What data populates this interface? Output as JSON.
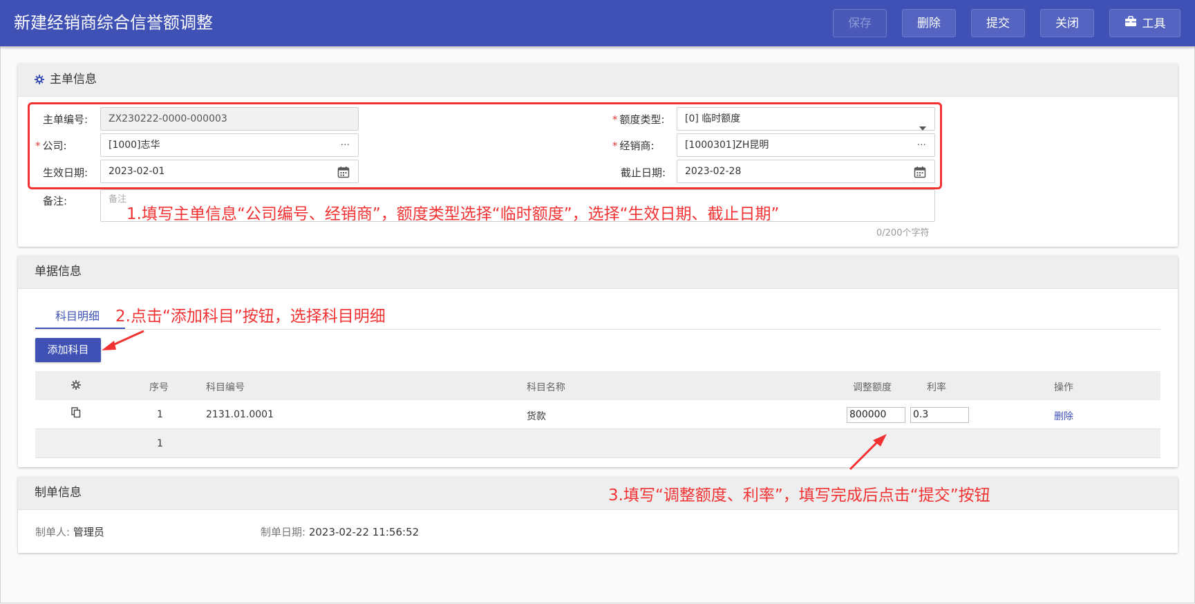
{
  "header": {
    "title": "新建经销商综合信誉额调整",
    "buttons": {
      "save": "保存",
      "delete": "删除",
      "submit": "提交",
      "close": "关闭",
      "tools": "工具"
    }
  },
  "main_info": {
    "title": "主单信息",
    "order_no": {
      "label": "主单编号:",
      "value": "ZX230222-0000-000003"
    },
    "company": {
      "required": "*",
      "label": "公司:",
      "value": "[1000]志华",
      "suffix": "···"
    },
    "effective_date": {
      "label": "生效日期:",
      "value": "2023-02-01"
    },
    "quota_type": {
      "required": "*",
      "label": "额度类型:",
      "value": "[0] 临时额度"
    },
    "dealer": {
      "required": "*",
      "label": "经销商:",
      "value": "[1000301]ZH昆明",
      "suffix": "···"
    },
    "end_date": {
      "label": "截止日期:",
      "value": "2023-02-28"
    },
    "remark": {
      "label": "备注:",
      "placeholder": "备注",
      "counter": "0/200个字符"
    }
  },
  "doc_info": {
    "title": "单据信息",
    "tab": "科目明细",
    "add_button": "添加科目",
    "columns": {
      "seq": "序号",
      "code": "科目编号",
      "name": "科目名称",
      "amount": "调整额度",
      "rate": "利率",
      "action": "操作"
    },
    "rows": [
      {
        "seq": "1",
        "code": "2131.01.0001",
        "name": "货款",
        "amount": "800000",
        "rate": "0.3",
        "action": "删除"
      }
    ],
    "summary": {
      "seq": "1"
    }
  },
  "maker_info": {
    "title": "制单信息",
    "maker_label": "制单人:",
    "maker": "管理员",
    "date_label": "制单日期:",
    "date": "2023-02-22 11:56:52"
  },
  "annotations": {
    "step1": "1.填写主单信息“公司编号、经销商”，额度类型选择“临时额度”，选择“生效日期、截止日期”",
    "step2": "2.点击“添加科目”按钮，选择科目明细",
    "step3": "3.填写“调整额度、利率”，填写完成后点击“提交”按钮"
  },
  "colors": {
    "primary": "#3f51b5",
    "annotation": "#f23232",
    "required": "#e53935"
  }
}
